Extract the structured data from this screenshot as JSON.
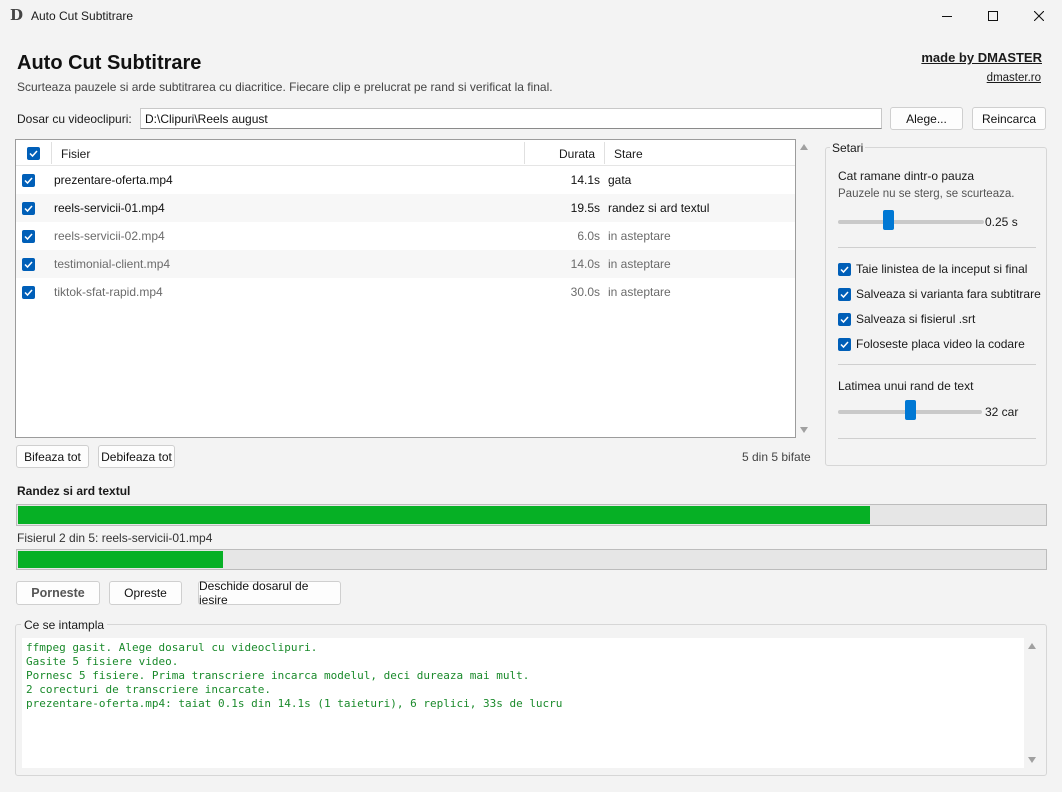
{
  "window": {
    "logo_letter": "D",
    "title": "Auto Cut Subtitrare"
  },
  "header": {
    "title": "Auto Cut Subtitrare",
    "subtitle": "Scurteaza pauzele si arde subtitrarea cu diacritice. Fiecare clip e prelucrat pe rand si verificat la final.",
    "made_by": "made by DMASTER",
    "site": "dmaster.ro"
  },
  "folder": {
    "label": "Dosar cu videoclipuri:",
    "value": "D:\\Clipuri\\Reels august",
    "choose_label": "Alege...",
    "reload_label": "Reincarca"
  },
  "file_list": {
    "columns": {
      "name": "Fisier",
      "duration": "Durata",
      "status": "Stare"
    },
    "rows": [
      {
        "name": "prezentare-oferta.mp4",
        "duration": "14.1s",
        "status": "gata",
        "checked": true
      },
      {
        "name": "reels-servicii-01.mp4",
        "duration": "19.5s",
        "status": "randez si ard textul",
        "checked": true
      },
      {
        "name": "reels-servicii-02.mp4",
        "duration": "6.0s",
        "status": "in asteptare",
        "checked": true
      },
      {
        "name": "testimonial-client.mp4",
        "duration": "14.0s",
        "status": "in asteptare",
        "checked": true
      },
      {
        "name": "tiktok-sfat-rapid.mp4",
        "duration": "30.0s",
        "status": "in asteptare",
        "checked": true
      }
    ],
    "check_all_label": "Bifeaza tot",
    "uncheck_all_label": "Debifeaza tot",
    "count_text": "5 din 5 bifate"
  },
  "settings": {
    "title": "Setari",
    "pause_label": "Cat ramane dintr-o pauza",
    "pause_hint": "Pauzele nu se sterg, se scurteaza.",
    "pause_value": "0.25 s",
    "pause_fraction": 0.34,
    "options": [
      {
        "label": "Taie linistea de la inceput si final",
        "checked": true
      },
      {
        "label": "Salveaza si varianta fara subtitrare",
        "checked": true
      },
      {
        "label": "Salveaza si fisierul .srt",
        "checked": true
      },
      {
        "label": "Foloseste placa video la codare",
        "checked": true
      }
    ],
    "width_label": "Latimea unui rand de text",
    "width_value": "32 car",
    "width_fraction": 0.5
  },
  "progress": {
    "label": "Randez si ard textul",
    "overall_fraction": 0.83,
    "file_label": "Fisierul 2 din 5: reels-servicii-01.mp4",
    "file_fraction": 0.2
  },
  "actions": {
    "start_label": "Porneste",
    "stop_label": "Opreste",
    "open_output_label": "Deschide dosarul de iesire"
  },
  "log": {
    "title": "Ce se intampla",
    "lines": [
      "ffmpeg gasit. Alege dosarul cu videoclipuri.",
      "Gasite 5 fisiere video.",
      "Pornesc 5 fisiere. Prima transcriere incarca modelul, deci dureaza mai mult.",
      "2 corecturi de transcriere incarcate.",
      "prezentare-oferta.mp4: taiat 0.1s din 14.1s (1 taieturi), 6 replici, 33s de lucru"
    ]
  },
  "colors": {
    "accent": "#005fb8",
    "progress": "#06b025",
    "log_text": "#1a8a2b"
  }
}
